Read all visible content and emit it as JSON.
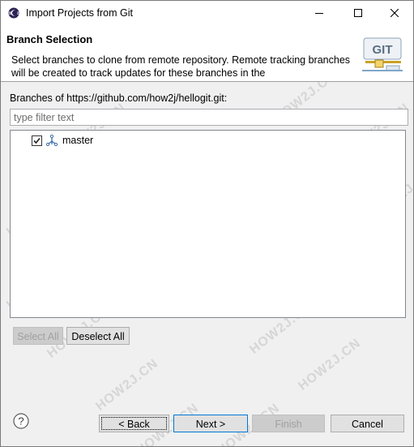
{
  "window": {
    "title": "Import Projects from Git",
    "minimize_icon": "minimize-icon",
    "maximize_icon": "maximize-icon",
    "close_icon": "close-icon"
  },
  "banner": {
    "title": "Branch Selection",
    "description": "Select branches to clone from remote repository. Remote tracking branches will be created to track updates for these branches in the",
    "logo_text": "GIT"
  },
  "branches": {
    "label": "Branches of https://github.com/how2j/hellogit.git:",
    "filter_placeholder": "type filter text",
    "filter_value": "",
    "items": [
      {
        "label": "master",
        "checked": true,
        "icon": "branch-icon"
      }
    ]
  },
  "selection_buttons": {
    "select_all": "Select All",
    "deselect_all": "Deselect All"
  },
  "footer": {
    "help_icon": "help-icon",
    "back": "< Back",
    "next": "Next >",
    "finish": "Finish",
    "cancel": "Cancel"
  },
  "watermark": "HOW2J.CN",
  "colors": {
    "accent": "#0078d7",
    "disabled_text": "#a0a0a0"
  }
}
